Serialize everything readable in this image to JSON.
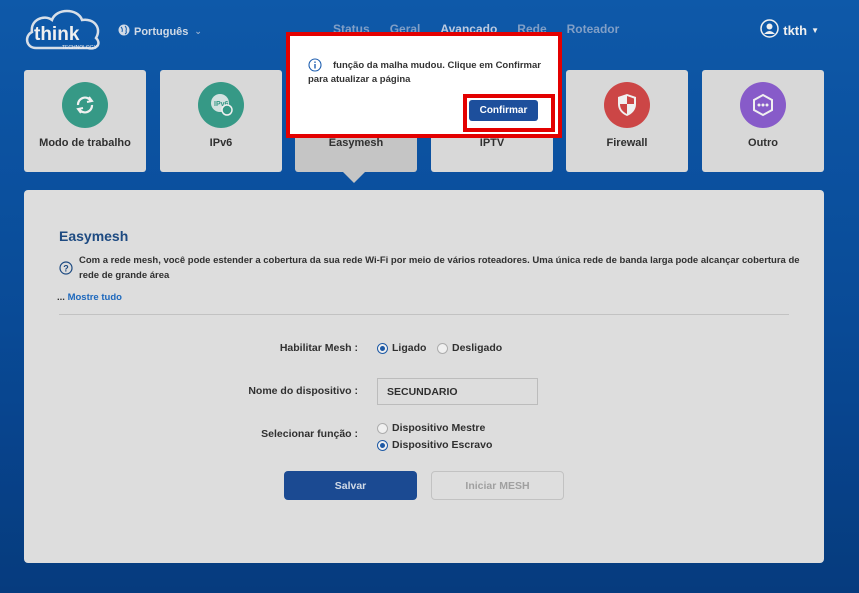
{
  "brand": {
    "logo_text": "think",
    "logo_subtext": "TECHNOLOGY"
  },
  "header": {
    "language": "Português",
    "nav": [
      "Status",
      "Geral",
      "Avançado",
      "Rede",
      "Roteador"
    ],
    "active_nav": "Avançado",
    "user": "tkth"
  },
  "tiles": [
    {
      "label": "Modo de trabalho",
      "icon": "refresh-icon",
      "color": "#3aa38f"
    },
    {
      "label": "IPv6",
      "icon": "ipv6-icon",
      "color": "#3aa38f"
    },
    {
      "label": "Easymesh",
      "icon": "easymesh-icon",
      "color": "#3aa38f",
      "selected": true
    },
    {
      "label": "IPTV",
      "icon": "iptv-icon",
      "color": "#3aa38f"
    },
    {
      "label": "Firewall",
      "icon": "shield-icon",
      "color": "#d94b4b"
    },
    {
      "label": "Outro",
      "icon": "more-icon",
      "color": "#9061d6"
    }
  ],
  "panel": {
    "title": "Easymesh",
    "description": "Com a rede mesh, você pode estender a cobertura da sua rede Wi-Fi por meio de vários roteadores. Uma única rede de banda larga pode alcançar cobertura de rede de grande área",
    "more_prefix": "...",
    "more_link": "Mostre tudo",
    "enable_mesh_label": "Habilitar Mesh :",
    "enable_on": "Ligado",
    "enable_off": "Desligado",
    "enable_value": "Ligado",
    "device_name_label": "Nome do dispositivo :",
    "device_name_value": "SECUNDARIO",
    "role_label": "Selecionar função :",
    "role_master": "Dispositivo Mestre",
    "role_slave": "Dispositivo Escravo",
    "role_value": "Dispositivo Escravo",
    "save_button": "Salvar",
    "start_mesh_button": "Iniciar MESH"
  },
  "modal": {
    "message": "função da malha mudou. Clique em Confirmar para atualizar a página",
    "confirm_button": "Confirmar"
  },
  "colors": {
    "background": "#0a4fa0",
    "accent": "#1d4f9c",
    "highlight": "#e30000"
  }
}
